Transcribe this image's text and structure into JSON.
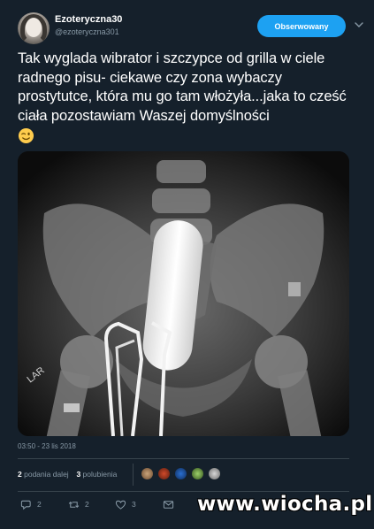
{
  "tweet": {
    "user_name": "Ezoteryczna30",
    "user_handle": "@ezoteryczna301",
    "follow_label": "Obserwowany",
    "text": "Tak wyglada wibrator i szczypce od grilla w ciele radnego pisu- ciekawe czy zona wybaczy prostytutce, która mu go tam włożyła...jaka to cześć ciała pozostawiam Waszej domyślności",
    "timestamp": "03:50 - 23 lis 2018",
    "retweets_count": "2",
    "retweets_label": "podania dalej",
    "likes_count": "3",
    "likes_label": "polubienia",
    "reply_count": "2",
    "retweet_action_count": "2",
    "like_action_count": "3"
  },
  "media": {
    "corner_text": "LAR"
  },
  "watermark": "www.wiocha.pl",
  "colors": {
    "background": "#15202b",
    "accent": "#1da1f2",
    "muted": "#8899a6",
    "divider": "#38444d"
  },
  "icons": [
    "more-chevron-icon",
    "reply-icon",
    "retweet-icon",
    "like-heart-icon",
    "direct-message-icon",
    "wink-emoji-icon"
  ]
}
